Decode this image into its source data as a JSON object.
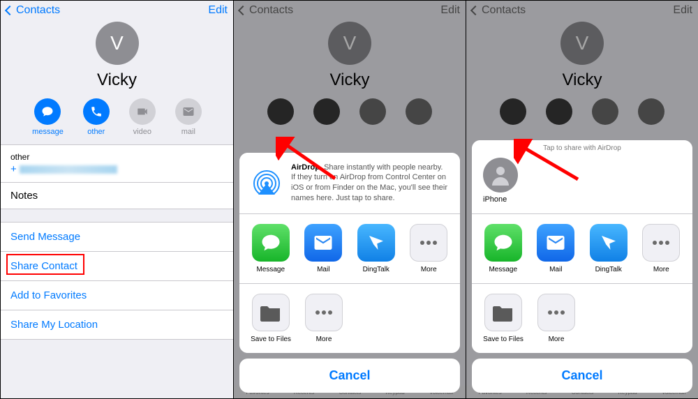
{
  "nav": {
    "back": "Contacts",
    "edit": "Edit"
  },
  "contact": {
    "initial": "V",
    "name": "Vicky",
    "phone_label": "other",
    "phone_prefix": "+",
    "notes_label": "Notes"
  },
  "actions": {
    "message": "message",
    "other": "other",
    "video": "video",
    "mail": "mail"
  },
  "links": {
    "send_message": "Send Message",
    "share_contact": "Share Contact",
    "add_favorites": "Add to Favorites",
    "share_location": "Share My Location"
  },
  "airdrop": {
    "title": "AirDrop",
    "text": ". Share instantly with people nearby. If they turn on AirDrop from Control Center on iOS or from Finder on the Mac, you'll see their names here. Just tap to share.",
    "hint": "Tap to share with AirDrop",
    "device": "iPhone"
  },
  "share_apps": {
    "message": "Message",
    "mail": "Mail",
    "dingtalk": "DingTalk",
    "more": "More",
    "save_files": "Save to Files"
  },
  "cancel": "Cancel",
  "tabbar": [
    "Favorites",
    "Recents",
    "Contacts",
    "Keypad",
    "Voicemail"
  ]
}
